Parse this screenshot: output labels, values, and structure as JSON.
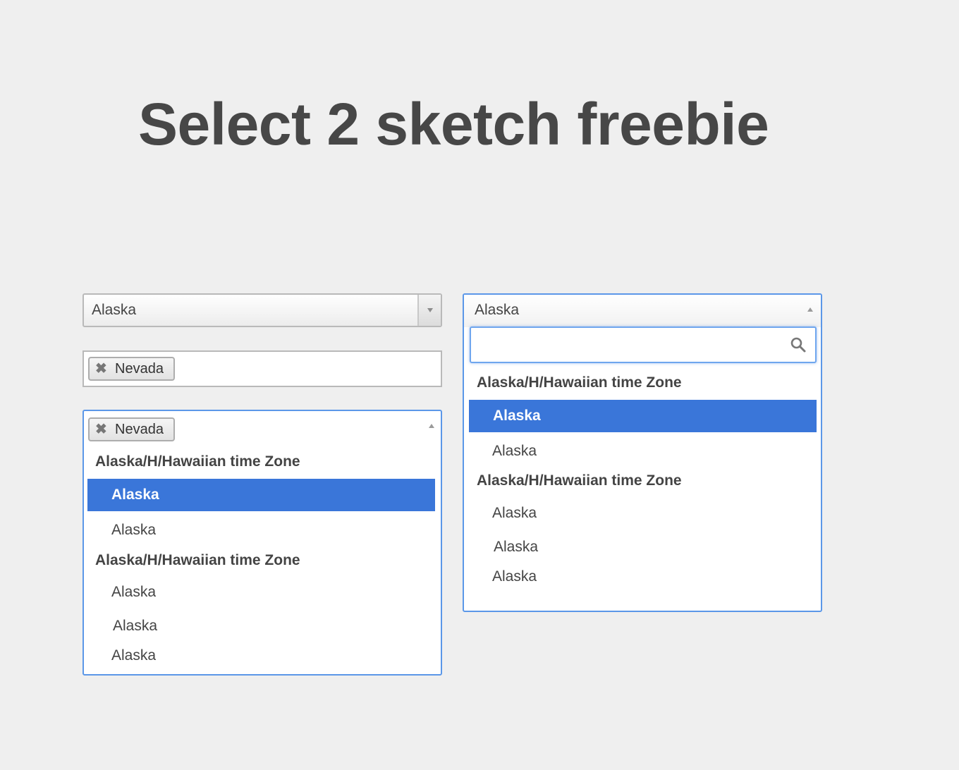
{
  "title": "Select 2 sketch freebie",
  "single_select": {
    "value": "Alaska"
  },
  "multi_select": {
    "tags": [
      "Nevada"
    ]
  },
  "multi_open": {
    "tags": [
      "Nevada"
    ],
    "groups": [
      {
        "label": "Alaska/H/Hawaiian time Zone",
        "options": [
          "Alaska",
          "Alaska"
        ]
      },
      {
        "label": "Alaska/H/Hawaiian time Zone",
        "options": [
          "Alaska",
          "Alaska",
          "Alaska"
        ]
      }
    ]
  },
  "single_open": {
    "value": "Alaska",
    "search_placeholder": "",
    "groups": [
      {
        "label": "Alaska/H/Hawaiian time Zone",
        "options": [
          "Alaska",
          "Alaska"
        ]
      },
      {
        "label": "Alaska/H/Hawaiian time Zone",
        "options": [
          "Alaska",
          "Alaska",
          "Alaska"
        ]
      }
    ]
  },
  "colors": {
    "accent": "#3a76d9",
    "focus_border": "#5b97e8",
    "background": "#efefef"
  },
  "icons": {
    "remove_tag": "close-icon",
    "dropdown": "chevron-down-icon",
    "collapse": "chevron-up-icon",
    "search": "search-icon"
  }
}
